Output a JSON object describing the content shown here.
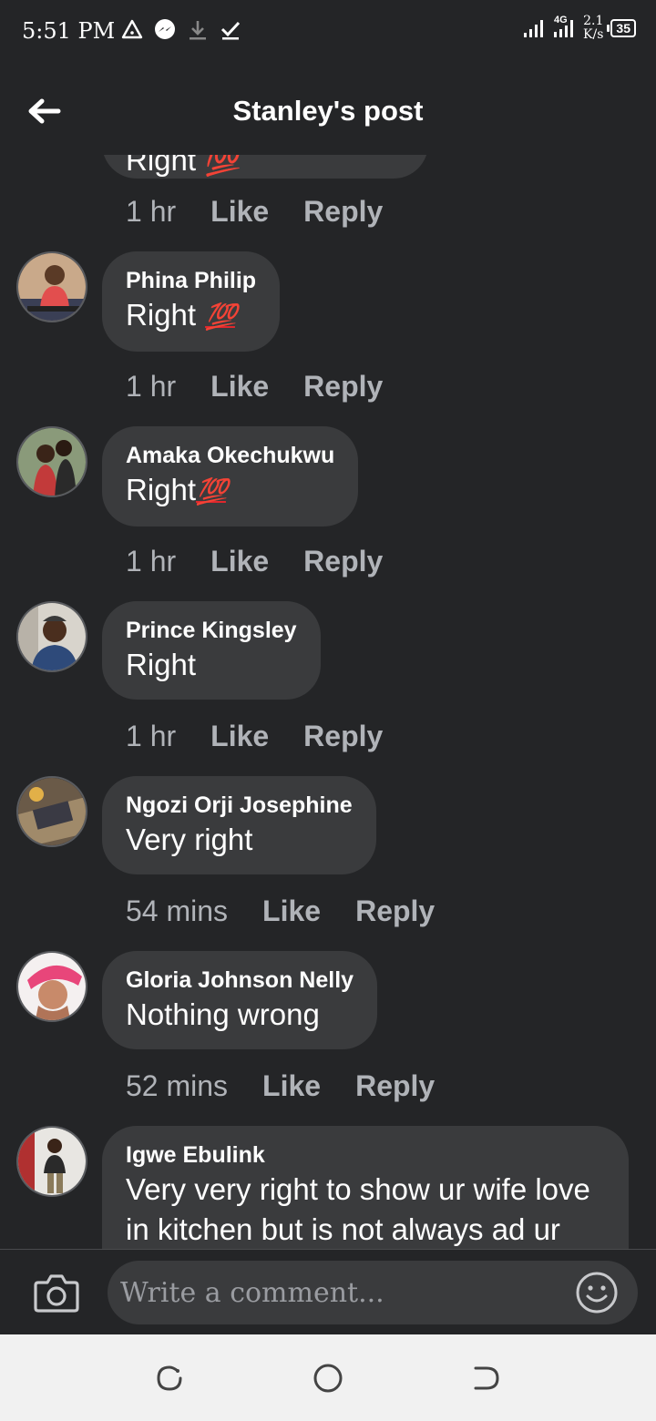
{
  "status_bar": {
    "time": "5:51 PM",
    "network": "4G",
    "speed_value": "2.1",
    "speed_unit": "K/s",
    "battery": "35"
  },
  "header": {
    "title": "Stanley's post"
  },
  "partial_comment": {
    "text": "Right 💯",
    "time": "1 hr",
    "like_label": "Like",
    "reply_label": "Reply"
  },
  "comments": [
    {
      "name": "Phina Philip",
      "text": "Right",
      "emoji": "💯",
      "time": "1 hr",
      "like_label": "Like",
      "reply_label": "Reply"
    },
    {
      "name": "Amaka Okechukwu",
      "text": "Right",
      "emoji": "💯",
      "time": "1 hr",
      "like_label": "Like",
      "reply_label": "Reply"
    },
    {
      "name": "Prince Kingsley",
      "text": "Right",
      "time": "1 hr",
      "like_label": "Like",
      "reply_label": "Reply"
    },
    {
      "name": "Ngozi Orji Josephine",
      "text": "Very right",
      "time": "54 mins",
      "like_label": "Like",
      "reply_label": "Reply"
    },
    {
      "name": "Gloria Johnson Nelly",
      "text": "Nothing wrong",
      "time": "52 mins",
      "like_label": "Like",
      "reply_label": "Reply"
    },
    {
      "name": "Igwe Ebulink",
      "text": "Very very right to show ur wife love in kitchen but is not always ad ur"
    }
  ],
  "composer": {
    "placeholder": "Write a comment..."
  },
  "colors": {
    "background": "#242527",
    "bubble": "#3a3b3d",
    "meta_text": "#b0b3b8",
    "hundred_emoji": "#e0272d",
    "nav_bar": "#f1f1f1"
  },
  "icons": {
    "back": "arrow-left-icon",
    "camera": "camera-icon",
    "emoji": "smiley-icon",
    "nav_recents": "recents-icon",
    "nav_home": "home-icon",
    "nav_back": "back-icon"
  }
}
